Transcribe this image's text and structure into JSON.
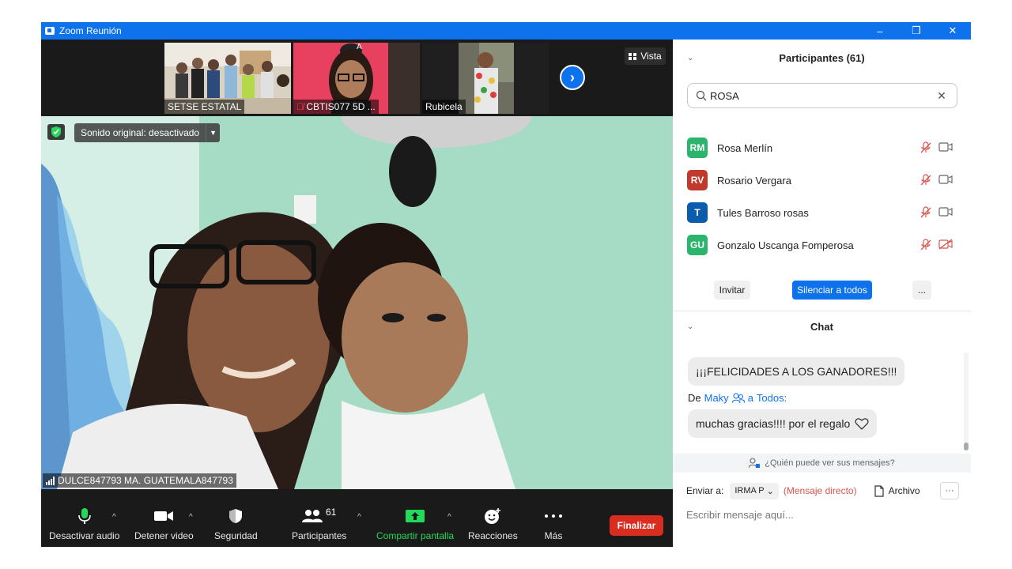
{
  "window": {
    "title": "Zoom Reunión",
    "minimize": "–",
    "restore": "❐",
    "close": "✕"
  },
  "thumbnails": [
    {
      "name": "SETSE ESTATAL"
    },
    {
      "name": "CBTIS077 5D ..."
    },
    {
      "name": "Rubicela"
    },
    {
      "name": ""
    }
  ],
  "view_button": {
    "label": "Vista"
  },
  "next_page": "›",
  "main_video": {
    "original_sound": "Sonido original: desactivado",
    "speaker_name": "DULCE847793 MA. GUATEMALA847793"
  },
  "toolbar": {
    "audio_label": "Desactivar audio",
    "video_label": "Detener video",
    "security_label": "Seguridad",
    "participants_label": "Participantes",
    "participants_count": "61",
    "share_label": "Compartir pantalla",
    "reactions_label": "Reacciones",
    "more_label": "Más",
    "end_label": "Finalizar"
  },
  "participants_panel": {
    "title": "Participantes (61)",
    "search_value": "ROSA",
    "participants": [
      {
        "initials": "RM",
        "name": "Rosa Merlín",
        "color": "#2bb46b",
        "video_on": true
      },
      {
        "initials": "RV",
        "name": "Rosario Vergara",
        "color": "#c0392b",
        "video_on": true
      },
      {
        "initials": "T",
        "name": "Tules Barroso rosas",
        "color": "#0b5cad",
        "video_on": true
      },
      {
        "initials": "GU",
        "name": "Gonzalo Uscanga Fomperosa",
        "color": "#2bb46b",
        "video_on": false
      }
    ],
    "invite": "Invitar",
    "mute_all": "Silenciar a todos",
    "more": "..."
  },
  "chat": {
    "title": "Chat",
    "message1": "¡¡¡FELICIDADES A LOS GANADORES!!!",
    "from_prefix": "De",
    "from_user": "Maky",
    "to_prefix": "a",
    "to_target": "Todos:",
    "message2": "muchas gracias!!!! por el regalo",
    "who_can_see": "¿Quién puede ver sus mensajes?",
    "send_to_label": "Enviar a:",
    "send_to_value": "IRMA P",
    "direct_message": "(Mensaje directo)",
    "file_label": "Archivo",
    "more": "···",
    "input_placeholder": "Escribir mensaje aquí..."
  },
  "colors": {
    "zoom_blue": "#0e72ed",
    "end_red": "#d92d20",
    "toolbar_bg": "#1a1a1a",
    "share_green": "#23d959",
    "muted_red": "#d9534f"
  }
}
